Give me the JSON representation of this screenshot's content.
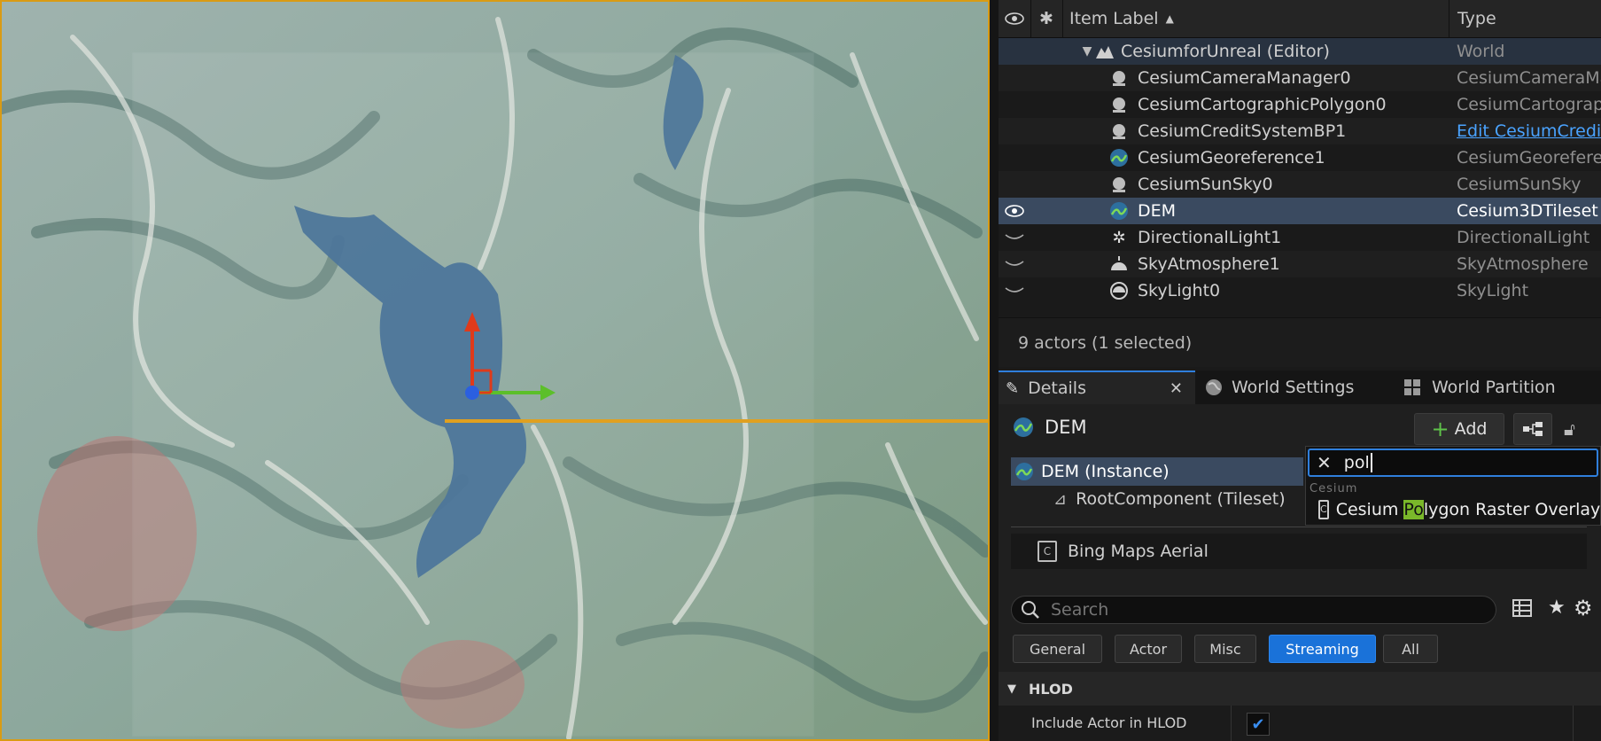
{
  "outliner": {
    "columns": {
      "label": "Item Label",
      "type": "Type"
    },
    "rows": [
      {
        "label": "CesiumforUnreal (Editor)",
        "type": "World",
        "icon": "world-icon"
      },
      {
        "label": "CesiumCameraManager0",
        "type": "CesiumCameraMa",
        "icon": "actor-icon"
      },
      {
        "label": "CesiumCartographicPolygon0",
        "type": "CesiumCartograph",
        "icon": "actor-icon"
      },
      {
        "label": "CesiumCreditSystemBP1",
        "type": "Edit CesiumCredit",
        "icon": "actor-icon"
      },
      {
        "label": "CesiumGeoreference1",
        "type": "CesiumGeoreferen",
        "icon": "cesium-icon"
      },
      {
        "label": "CesiumSunSky0",
        "type": "CesiumSunSky",
        "icon": "actor-icon"
      },
      {
        "label": "DEM",
        "type": "Cesium3DTileset",
        "icon": "cesium-icon"
      },
      {
        "label": "DirectionalLight1",
        "type": "DirectionalLight",
        "icon": "sun-icon"
      },
      {
        "label": "SkyAtmosphere1",
        "type": "SkyAtmosphere",
        "icon": "atmosphere-icon"
      },
      {
        "label": "SkyLight0",
        "type": "SkyLight",
        "icon": "skylight-icon"
      }
    ],
    "status": "9 actors (1 selected)"
  },
  "tabs": [
    {
      "label": "Details",
      "icon": "pencil-icon"
    },
    {
      "label": "World Settings",
      "icon": "globe-icon"
    },
    {
      "label": "World Partition",
      "icon": "grid-icon"
    }
  ],
  "details": {
    "actor_name": "DEM",
    "add_label": "Add",
    "components": [
      {
        "label": "DEM (Instance)"
      },
      {
        "label": "RootComponent (Tileset)"
      },
      {
        "label": "Bing Maps Aerial"
      }
    ],
    "search_placeholder": "Search",
    "filters": [
      "General",
      "Actor",
      "Misc",
      "Streaming",
      "All"
    ],
    "active_filter": "Streaming",
    "section": "HLOD",
    "property": {
      "label": "Include Actor in HLOD",
      "checked": true
    }
  },
  "add_popup": {
    "query": "pol",
    "category": "Cesium",
    "result_prefix": "Cesium ",
    "result_highlight": "Po",
    "result_suffix": "lygon Raster Overlay"
  },
  "colors": {
    "accent": "#1a72d9",
    "viewport_border": "#d99b14",
    "selection": "#3a4a60",
    "highlight": "#7ab82a"
  }
}
